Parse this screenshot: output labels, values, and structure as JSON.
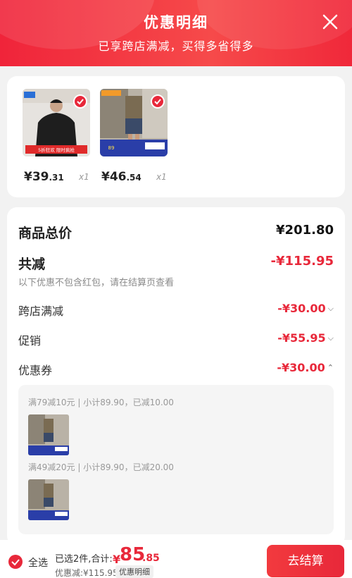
{
  "header": {
    "title": "优惠明细",
    "subtitle": "已享跨店满减，买得多省得多"
  },
  "products": [
    {
      "price_int": "¥39",
      "price_dec": ".31",
      "qty": "x1",
      "image": "black sweatshirt photo",
      "image_text": "5折狂欢 限时疯抢"
    },
    {
      "price_int": "¥46",
      "price_dec": ".54",
      "qty": "x1",
      "image": "striped shirt and denim shorts photo",
      "image_text": "89"
    }
  ],
  "summary": {
    "total_label": "商品总价",
    "total_value": "¥201.80",
    "reduce_label": "共减",
    "reduce_value": "-¥115.95",
    "note": "以下优惠不包含红包，请在结算页查看",
    "items": [
      {
        "label": "跨店满减",
        "value": "-¥30.00",
        "chevron": "chevron-down"
      },
      {
        "label": "促销",
        "value": "-¥55.95",
        "chevron": "chevron-down"
      },
      {
        "label": "优惠券",
        "value": "-¥30.00",
        "chevron": "chevron-up"
      }
    ]
  },
  "coupons": [
    {
      "text": "满79减10元 | 小计89.90，已减10.00"
    },
    {
      "text": "满49减20元 | 小计89.90，已减20.00"
    }
  ],
  "bottom": {
    "select_all": "全选",
    "summary_text": "已选2件,合计:",
    "total_yen": "¥",
    "total_int": "85",
    "total_dec": ".85",
    "saved_text": "优惠减:¥115.95",
    "detail_tag": "优惠明细",
    "checkout": "去结算"
  },
  "colors": {
    "brand_red": "#e8283a",
    "header_gradient": "#f0243a"
  }
}
